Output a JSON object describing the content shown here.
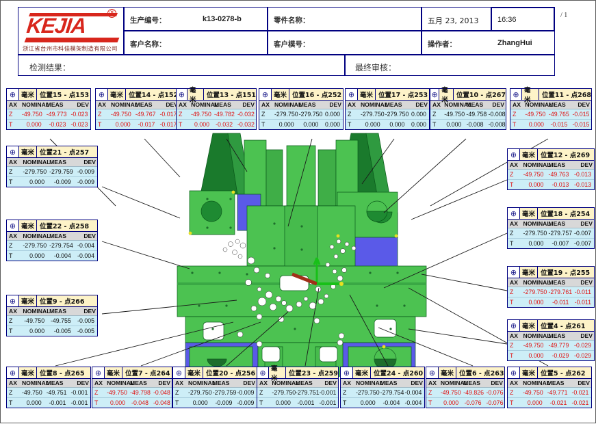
{
  "header": {
    "logo": {
      "brand": "KEJIA",
      "registered_mark": "®",
      "subtitle": "浙江省台州市科佳模架制造有限公司"
    },
    "fields": [
      {
        "label": "生产编号：",
        "value": "k13-0278-b"
      },
      {
        "label": "零件名称：",
        "value": ""
      },
      {
        "label": "客户名称：",
        "value": ""
      },
      {
        "label": "客户模号：",
        "value": ""
      },
      {
        "label": "操作者：",
        "value": "ZhangHui"
      },
      {
        "label": "检测结果：",
        "value": ""
      },
      {
        "label": "最终审核：",
        "value": ""
      }
    ],
    "date": "五月 23, 2013",
    "time": "16:36",
    "page_number": "/ 1"
  },
  "measurement_table": {
    "columns": [
      "AX",
      "NOMINAL",
      "MEAS",
      "DEV"
    ],
    "unit_label": "毫米",
    "icon": "position-tolerance-icon"
  },
  "boxes": [
    {
      "id": "b15",
      "title": "位置15 - 点153",
      "color": "red",
      "rows": [
        {
          "ax": "Z",
          "nominal": "-49.750",
          "meas": "-49.773",
          "dev": "-0.023"
        },
        {
          "ax": "T",
          "nominal": "0.000",
          "meas": "-0.023",
          "dev": "-0.023"
        }
      ]
    },
    {
      "id": "b14",
      "title": "位置14 - 点152",
      "color": "red",
      "rows": [
        {
          "ax": "Z",
          "nominal": "-49.750",
          "meas": "-49.767",
          "dev": "-0.017"
        },
        {
          "ax": "T",
          "nominal": "0.000",
          "meas": "-0.017",
          "dev": "-0.017"
        }
      ]
    },
    {
      "id": "b13",
      "title": "位置13 - 点151",
      "color": "red",
      "rows": [
        {
          "ax": "Z",
          "nominal": "-49.750",
          "meas": "-49.782",
          "dev": "-0.032"
        },
        {
          "ax": "T",
          "nominal": "0.000",
          "meas": "-0.032",
          "dev": "-0.032"
        }
      ]
    },
    {
      "id": "b16",
      "title": "位置16 - 点252",
      "color": "black",
      "rows": [
        {
          "ax": "Z",
          "nominal": "-279.750",
          "meas": "-279.750",
          "dev": "0.000"
        },
        {
          "ax": "T",
          "nominal": "0.000",
          "meas": "0.000",
          "dev": "0.000"
        }
      ]
    },
    {
      "id": "b17",
      "title": "位置17 - 点253",
      "color": "black",
      "rows": [
        {
          "ax": "Z",
          "nominal": "-279.750",
          "meas": "-279.750",
          "dev": "0.000"
        },
        {
          "ax": "T",
          "nominal": "0.000",
          "meas": "0.000",
          "dev": "0.000"
        }
      ]
    },
    {
      "id": "b10",
      "title": "位置10 - 点267",
      "color": "black",
      "rows": [
        {
          "ax": "Z",
          "nominal": "-49.750",
          "meas": "-49.758",
          "dev": "-0.008"
        },
        {
          "ax": "T",
          "nominal": "0.000",
          "meas": "-0.008",
          "dev": "-0.008"
        }
      ]
    },
    {
      "id": "b11",
      "title": "位置11 - 点268",
      "color": "red",
      "rows": [
        {
          "ax": "Z",
          "nominal": "-49.750",
          "meas": "-49.765",
          "dev": "-0.015"
        },
        {
          "ax": "T",
          "nominal": "0.000",
          "meas": "-0.015",
          "dev": "-0.015"
        }
      ]
    },
    {
      "id": "b21",
      "title": "位置21 - 点257",
      "color": "black",
      "rows": [
        {
          "ax": "Z",
          "nominal": "-279.750",
          "meas": "-279.759",
          "dev": "-0.009"
        },
        {
          "ax": "T",
          "nominal": "0.000",
          "meas": "-0.009",
          "dev": "-0.009"
        }
      ]
    },
    {
      "id": "b22",
      "title": "位置22 - 点258",
      "color": "black",
      "rows": [
        {
          "ax": "Z",
          "nominal": "-279.750",
          "meas": "-279.754",
          "dev": "-0.004"
        },
        {
          "ax": "T",
          "nominal": "0.000",
          "meas": "-0.004",
          "dev": "-0.004"
        }
      ]
    },
    {
      "id": "b9",
      "title": "位置9 - 点266",
      "color": "black",
      "rows": [
        {
          "ax": "Z",
          "nominal": "-49.750",
          "meas": "-49.755",
          "dev": "-0.005"
        },
        {
          "ax": "T",
          "nominal": "0.000",
          "meas": "-0.005",
          "dev": "-0.005"
        }
      ]
    },
    {
      "id": "b12",
      "title": "位置12 - 点269",
      "color": "red",
      "rows": [
        {
          "ax": "Z",
          "nominal": "-49.750",
          "meas": "-49.763",
          "dev": "-0.013"
        },
        {
          "ax": "T",
          "nominal": "0.000",
          "meas": "-0.013",
          "dev": "-0.013"
        }
      ]
    },
    {
      "id": "b18",
      "title": "位置18 - 点254",
      "color": "black",
      "rows": [
        {
          "ax": "Z",
          "nominal": "-279.750",
          "meas": "-279.757",
          "dev": "-0.007"
        },
        {
          "ax": "T",
          "nominal": "0.000",
          "meas": "-0.007",
          "dev": "-0.007"
        }
      ]
    },
    {
      "id": "b19",
      "title": "位置19 - 点255",
      "color": "red",
      "rows": [
        {
          "ax": "Z",
          "nominal": "-279.750",
          "meas": "-279.761",
          "dev": "-0.011"
        },
        {
          "ax": "T",
          "nominal": "0.000",
          "meas": "-0.011",
          "dev": "-0.011"
        }
      ]
    },
    {
      "id": "b4",
      "title": "位置4 - 点261",
      "color": "red",
      "rows": [
        {
          "ax": "Z",
          "nominal": "-49.750",
          "meas": "-49.779",
          "dev": "-0.029"
        },
        {
          "ax": "T",
          "nominal": "0.000",
          "meas": "-0.029",
          "dev": "-0.029"
        }
      ]
    },
    {
      "id": "b8",
      "title": "位置8 - 点265",
      "color": "black",
      "rows": [
        {
          "ax": "Z",
          "nominal": "-49.750",
          "meas": "-49.751",
          "dev": "-0.001"
        },
        {
          "ax": "T",
          "nominal": "0.000",
          "meas": "-0.001",
          "dev": "-0.001"
        }
      ]
    },
    {
      "id": "b7",
      "title": "位置7 - 点264",
      "color": "red",
      "rows": [
        {
          "ax": "Z",
          "nominal": "-49.750",
          "meas": "-49.798",
          "dev": "-0.048"
        },
        {
          "ax": "T",
          "nominal": "0.000",
          "meas": "-0.048",
          "dev": "-0.048"
        }
      ]
    },
    {
      "id": "b20",
      "title": "位置20 - 点256",
      "color": "black",
      "rows": [
        {
          "ax": "Z",
          "nominal": "-279.750",
          "meas": "-279.759",
          "dev": "-0.009"
        },
        {
          "ax": "T",
          "nominal": "0.000",
          "meas": "-0.009",
          "dev": "-0.009"
        }
      ]
    },
    {
      "id": "b23",
      "title": "位置23 - 点259",
      "color": "black",
      "rows": [
        {
          "ax": "Z",
          "nominal": "-279.750",
          "meas": "-279.751",
          "dev": "-0.001"
        },
        {
          "ax": "T",
          "nominal": "0.000",
          "meas": "-0.001",
          "dev": "-0.001"
        }
      ]
    },
    {
      "id": "b24",
      "title": "位置24 - 点260",
      "color": "black",
      "rows": [
        {
          "ax": "Z",
          "nominal": "-279.750",
          "meas": "-279.754",
          "dev": "-0.004"
        },
        {
          "ax": "T",
          "nominal": "0.000",
          "meas": "-0.004",
          "dev": "-0.004"
        }
      ]
    },
    {
      "id": "b6",
      "title": "位置6 - 点263",
      "color": "red",
      "rows": [
        {
          "ax": "Z",
          "nominal": "-49.750",
          "meas": "-49.826",
          "dev": "-0.076"
        },
        {
          "ax": "T",
          "nominal": "0.000",
          "meas": "-0.076",
          "dev": "-0.076"
        }
      ]
    },
    {
      "id": "b5",
      "title": "位置5 - 点262",
      "color": "red",
      "rows": [
        {
          "ax": "Z",
          "nominal": "-49.750",
          "meas": "-49.771",
          "dev": "-0.021"
        },
        {
          "ax": "T",
          "nominal": "0.000",
          "meas": "-0.021",
          "dev": "-0.021"
        }
      ]
    }
  ],
  "cad": {
    "model_name": "mold-base-plate",
    "colors": {
      "body_green": "#4cc251",
      "dark_green": "#1e8a32",
      "blue_face": "#5a5ae8",
      "outline": "#0a5a1a",
      "axis_x": "#b03010",
      "axis_y": "#18c018",
      "axis_z": "#2a2a2a"
    }
  }
}
